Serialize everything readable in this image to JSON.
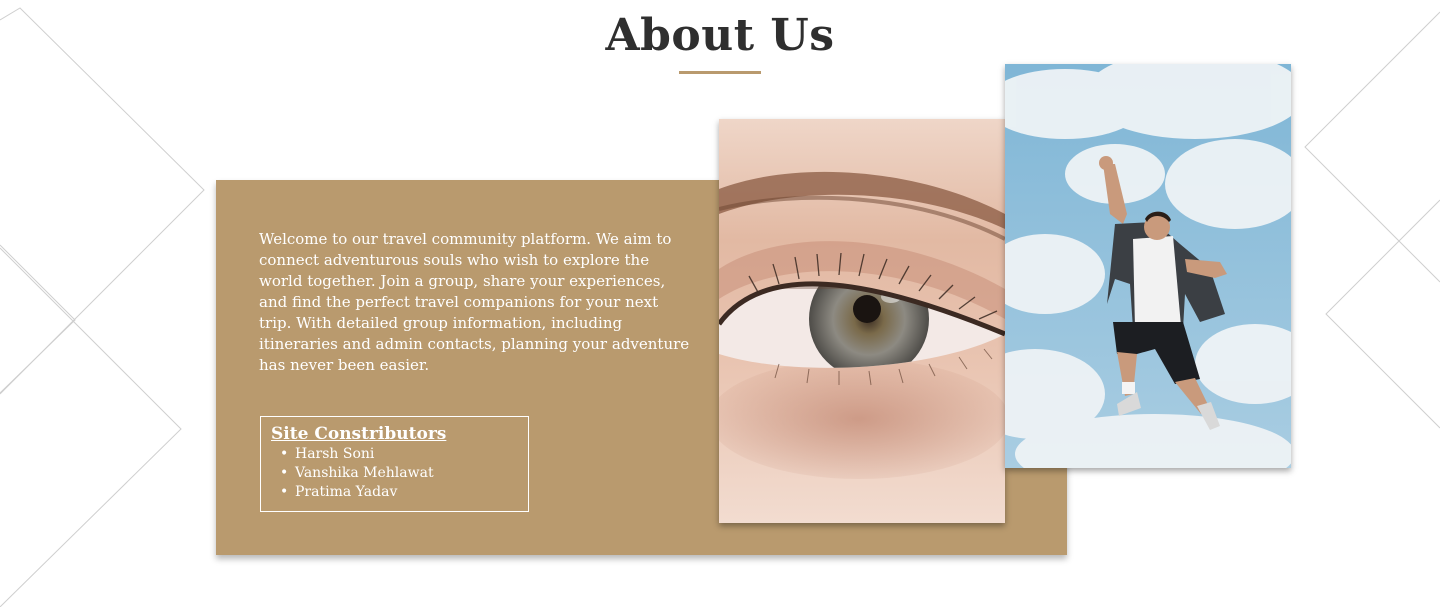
{
  "section": {
    "title": "About Us"
  },
  "about": {
    "description": "Welcome to our travel community platform. We aim to connect adventurous souls who wish to explore the world together. Join a group, share your experiences, and find the perfect travel companions for your next trip. With detailed group information, including itineraries and admin contacts, planning your adventure has never been easier.",
    "contributors": {
      "title": "Site Constributors",
      "names": [
        "Harsh Soni",
        "Vanshika Mehlawat",
        "Pratima Yadav"
      ]
    }
  },
  "images": [
    {
      "icon": "eye-closeup-photo"
    },
    {
      "icon": "jumping-man-photo"
    }
  ],
  "colors": {
    "accent": "#b99a6e",
    "heading": "#2f2f2f",
    "text_on_accent": "#ffffff",
    "background": "#ffffff",
    "decor_lines": "#c8c8c8"
  }
}
